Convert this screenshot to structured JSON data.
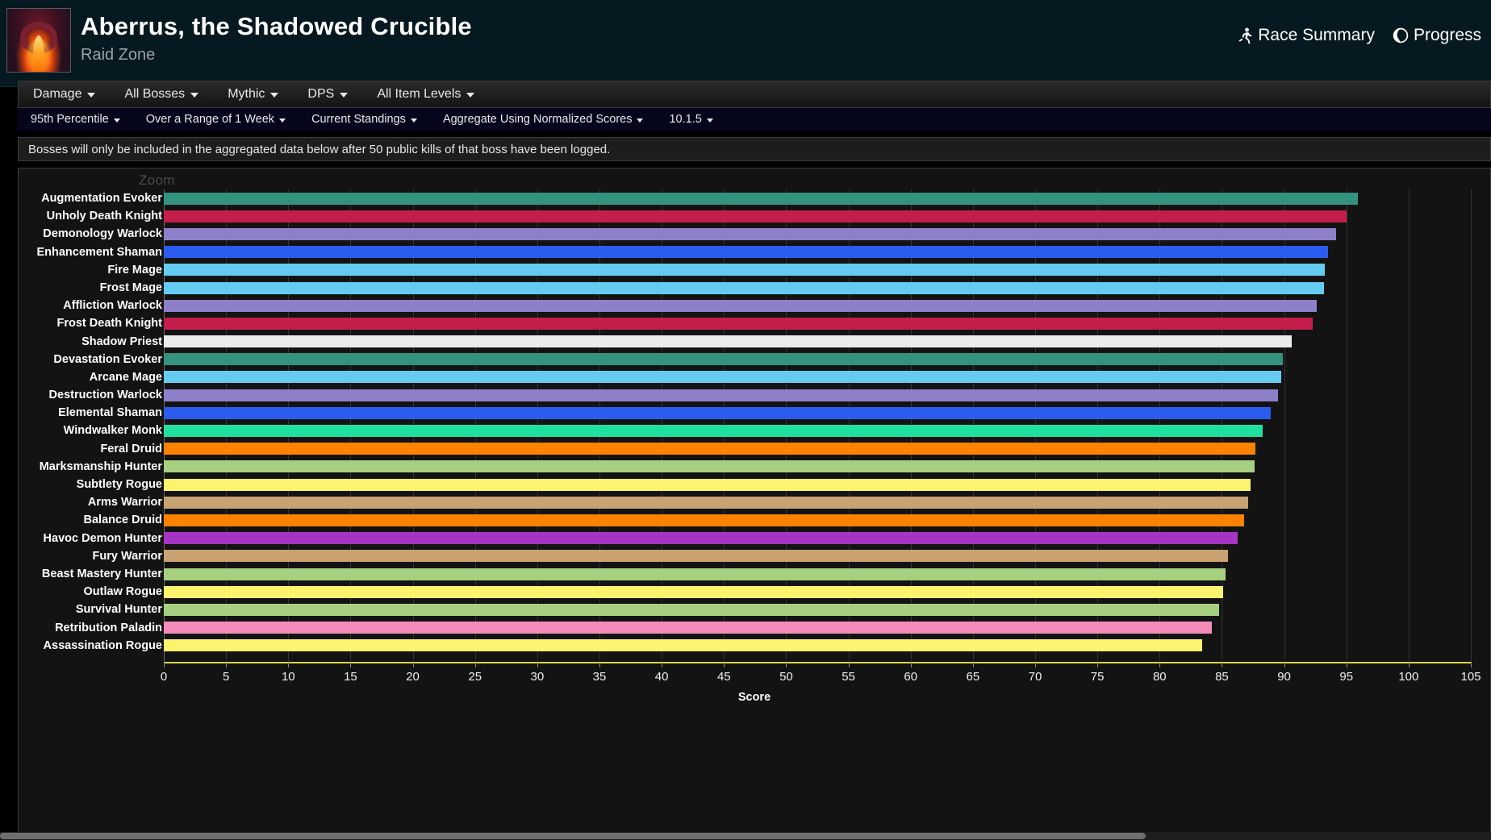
{
  "header": {
    "zone_title": "Aberrus, the Shadowed Crucible",
    "zone_subtitle": "Raid Zone",
    "zone_icon_name": "raid-zone-icon",
    "nav": [
      {
        "label": "Race Summary",
        "icon": "runner-icon",
        "glyph": "⯒"
      },
      {
        "label": "Progress",
        "icon": "globe-icon",
        "glyph": "◔"
      }
    ]
  },
  "filters_primary": [
    {
      "label": "Damage"
    },
    {
      "label": "All Bosses"
    },
    {
      "label": "Mythic"
    },
    {
      "label": "DPS"
    },
    {
      "label": "All Item Levels"
    }
  ],
  "filters_secondary": [
    {
      "label": "95th Percentile"
    },
    {
      "label": "Over a Range of 1 Week"
    },
    {
      "label": "Current Standings"
    },
    {
      "label": "Aggregate Using Normalized Scores"
    },
    {
      "label": "10.1.5"
    }
  ],
  "notice": {
    "text": "Bosses will only be included in the aggregated data below after 50 public kills of that boss have been logged."
  },
  "chart_controls": {
    "zoom_label": "Zoom"
  },
  "chart_data": {
    "type": "bar",
    "orientation": "horizontal",
    "title": "",
    "xlabel": "Score",
    "ylabel": "",
    "xlim": [
      0,
      105
    ],
    "xticks": [
      0,
      5,
      10,
      15,
      20,
      25,
      30,
      35,
      40,
      45,
      50,
      55,
      60,
      65,
      70,
      75,
      80,
      85,
      90,
      95,
      100,
      105
    ],
    "grid": true,
    "legend": "none",
    "categories": [
      "Augmentation Evoker",
      "Unholy Death Knight",
      "Demonology Warlock",
      "Enhancement Shaman",
      "Fire Mage",
      "Frost Mage",
      "Affliction Warlock",
      "Frost Death Knight",
      "Shadow Priest",
      "Devastation Evoker",
      "Arcane Mage",
      "Destruction Warlock",
      "Elemental Shaman",
      "Windwalker Monk",
      "Feral Druid",
      "Marksmanship Hunter",
      "Subtlety Rogue",
      "Arms Warrior",
      "Balance Druid",
      "Havoc Demon Hunter",
      "Fury Warrior",
      "Beast Mastery Hunter",
      "Outlaw Rogue",
      "Survival Hunter",
      "Retribution Paladin",
      "Assassination Rogue"
    ],
    "values": [
      95.9,
      95.0,
      94.2,
      93.5,
      93.3,
      93.2,
      92.6,
      92.3,
      90.6,
      89.9,
      89.8,
      89.5,
      88.9,
      88.3,
      87.7,
      87.6,
      87.3,
      87.1,
      86.8,
      86.3,
      85.5,
      85.3,
      85.1,
      84.8,
      84.2,
      83.4
    ],
    "colors": [
      "#33937f",
      "#c41e4a",
      "#8d80c9",
      "#2a5cf0",
      "#64ccf0",
      "#64ccf0",
      "#8d80c9",
      "#c41e4a",
      "#ececec",
      "#33937f",
      "#64ccf0",
      "#8d80c9",
      "#2a5cf0",
      "#20e0a0",
      "#fc8200",
      "#a6d07f",
      "#fcf36e",
      "#c9a272",
      "#fc8200",
      "#a634c4",
      "#c9a272",
      "#a6d07f",
      "#fcf36e",
      "#a6d07f",
      "#f48cba",
      "#fcf36e"
    ]
  },
  "colors": {
    "header_bg": "#061820",
    "accent_axis": "#d8d84a",
    "panel_bg": "#131313"
  }
}
